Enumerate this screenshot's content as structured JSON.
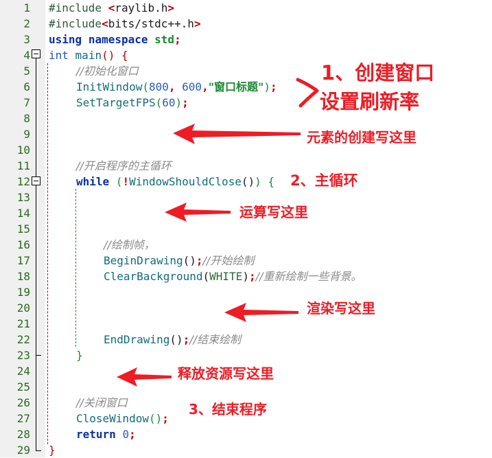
{
  "editor": {
    "lines": [
      {
        "n": "1"
      },
      {
        "n": "2"
      },
      {
        "n": "3"
      },
      {
        "n": "4"
      },
      {
        "n": "5"
      },
      {
        "n": "6"
      },
      {
        "n": "7"
      },
      {
        "n": "8"
      },
      {
        "n": "9"
      },
      {
        "n": "10"
      },
      {
        "n": "11"
      },
      {
        "n": "12"
      },
      {
        "n": "13"
      },
      {
        "n": "14"
      },
      {
        "n": "15"
      },
      {
        "n": "16"
      },
      {
        "n": "17"
      },
      {
        "n": "18"
      },
      {
        "n": "19"
      },
      {
        "n": "20"
      },
      {
        "n": "21"
      },
      {
        "n": "22"
      },
      {
        "n": "23"
      },
      {
        "n": "24"
      },
      {
        "n": "25"
      },
      {
        "n": "26"
      },
      {
        "n": "27"
      },
      {
        "n": "28"
      },
      {
        "n": "29"
      }
    ],
    "tokens": {
      "include": "#include",
      "sp": " ",
      "lt": "<",
      "gt": ">",
      "raylib_h": "raylib.h",
      "bits_h": "bits/stdc++.h",
      "using": "using",
      "namespace": "namespace",
      "std": "std",
      "semi": ";",
      "int": "int",
      "main": "main",
      "lparen": "(",
      "rparen": ")",
      "lbrace": "{",
      "rbrace": "}",
      "cmt_init": "//初始化窗口",
      "InitWindow": "InitWindow",
      "n800": "800",
      "comma": ",",
      "n600": "600",
      "title_str": "\"窗口标题\"",
      "SetTargetFPS": "SetTargetFPS",
      "n60": "60",
      "cmt_loop": "//开启程序的主循环",
      "while": "while",
      "bang": "!",
      "WindowShouldClose": "WindowShouldClose",
      "cmt_frame": "//绘制帧，",
      "BeginDrawing": "BeginDrawing",
      "cmt_begin": "//开始绘制",
      "ClearBackground": "ClearBackground",
      "WHITE": "WHITE",
      "cmt_clear": "//重新绘制一些背景。",
      "EndDrawing": "EndDrawing",
      "cmt_end": "//结束绘制",
      "cmt_close": "//关闭窗口",
      "CloseWindow": "CloseWindow",
      "return": "return",
      "zero": "0"
    }
  },
  "annotations": {
    "step1_line1": "1、创建窗口",
    "step1_line2": "设置刷新率",
    "create_elements": "元素的创建写这里",
    "step2": "2、主循环",
    "compute": "运算写这里",
    "render": "渲染写这里",
    "release": "释放资源写这里",
    "step3": "3、结束程序"
  },
  "colors": {
    "annotation_red": "#ee1c25",
    "line_number_green": "#2b6a1f",
    "gutter_bg": "#f0f0f0"
  }
}
